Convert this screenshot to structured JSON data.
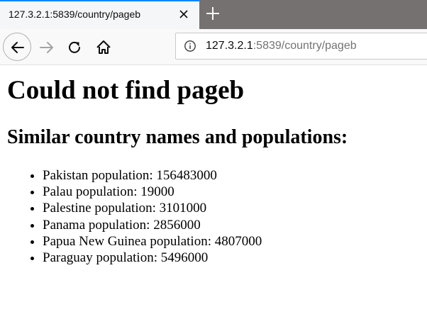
{
  "browser": {
    "tab": {
      "title": "127.3.2.1:5839/country/pageb"
    },
    "address_bar": {
      "host": "127.3.2.1",
      "rest": ":5839/country/pageb"
    },
    "icons": {
      "back": "back-arrow-icon",
      "forward": "forward-arrow-icon",
      "reload": "reload-icon",
      "home": "home-icon",
      "info": "info-icon",
      "close": "close-icon",
      "new_tab": "plus-icon"
    }
  },
  "page": {
    "heading": "Could not find pageb",
    "subheading": "Similar country names and populations:",
    "items": [
      "Pakistan population: 156483000",
      "Palau population: 19000",
      "Palestine population: 3101000",
      "Panama population: 2856000",
      "Papua New Guinea population: 4807000",
      "Paraguay population: 5496000"
    ]
  },
  "colors": {
    "tabstrip": "#757171",
    "active_tab": "#f5f6f7",
    "tab_accent": "#0a84ff",
    "navbar": "#f9f9fa"
  }
}
